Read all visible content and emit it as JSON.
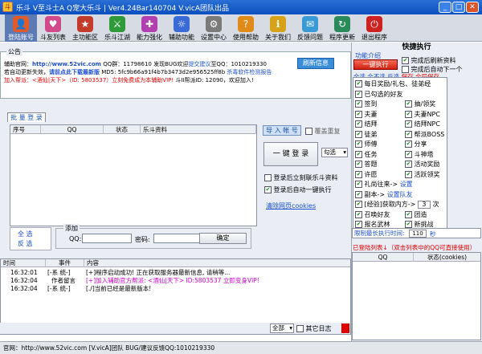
{
  "window": {
    "title": "乐斗 V至斗士A Q宠大乐斗 | Ver4.24Bar140704 V.vicA团队出品",
    "min_label": "_",
    "max_label": "□",
    "close_label": "✕"
  },
  "toolbar": {
    "items": [
      {
        "label": "登陆账号",
        "icon": "login-icon",
        "color": "#e05a2a"
      },
      {
        "label": "斗友列表",
        "icon": "friends-icon",
        "color": "#d14a8a"
      },
      {
        "label": "主功能区",
        "icon": "main-icon",
        "color": "#c23b2b"
      },
      {
        "label": "乐斗江湖",
        "icon": "jianghu-icon",
        "color": "#2e9a3a"
      },
      {
        "label": "能力强化",
        "icon": "enhance-icon",
        "color": "#b23fb0"
      },
      {
        "label": "辅助功能",
        "icon": "assist-icon",
        "color": "#3a6ad6"
      },
      {
        "label": "设置中心",
        "icon": "settings-icon",
        "color": "#7a7a7a"
      },
      {
        "label": "使用帮助",
        "icon": "help-icon",
        "color": "#e08a1a"
      },
      {
        "label": "关于我们",
        "icon": "about-icon",
        "color": "#d6a21a"
      },
      {
        "label": "反馈问题",
        "icon": "feedback-icon",
        "color": "#3a9ad6"
      },
      {
        "label": "程序更新",
        "icon": "update-icon",
        "color": "#2a8a5a"
      },
      {
        "label": "退出程序",
        "icon": "exit-icon",
        "color": "#c22"
      }
    ]
  },
  "notice": {
    "legend": "公告",
    "refresh_label": "刷新信息",
    "line1_a": "辅助官网：",
    "line1_url": "http://www.52vic.com",
    "line1_b": "  QQ群：11798610  发现BUG欢迎",
    "line1_c": "提交建议",
    "line1_d": "至QQ：1010219330",
    "line2_a": "若自动更新失效，",
    "line2_b": "请前点此下载最新版",
    "line2_c": "   MD5: 5fc9b66a91f4b7b3473d2e956525ff8b",
    "line2_d": "  杀毒软件检测报告",
    "line3_a": "加入帮派：<酒仙|天下>（ID: 5803537）立刻免费成为本辅助VIP!",
    "line3_b": "斗II帮派ID: 12090，欢迎加入!"
  },
  "batch": {
    "tab_label": "批 量 登 录",
    "columns": [
      "序号",
      "QQ",
      "状态",
      "乐斗资料"
    ],
    "import_label": "导 入 帐 号",
    "cover_label": "覆盖重复",
    "login_label": "一 键 登 录",
    "select_value": "勾选",
    "open_after_label": "登录后立刻联乐斗资料",
    "auto_exec_label": "登录后自动一键执行",
    "clear_cookies": "清除网页cookies",
    "select_all": "全 选",
    "invert": "反 选"
  },
  "add": {
    "legend": "添加",
    "qq_label": "QQ:",
    "pwd_label": "密码:",
    "confirm_label": "确定"
  },
  "log": {
    "columns": [
      "时间",
      "事件",
      "内容"
    ],
    "rows": [
      {
        "time": "16:32:01",
        "event": "[-系 统-]",
        "content": "[+]程序启动成功! 正在获取服务器最新信息, 请稍等..."
      },
      {
        "time": "16:32:04",
        "event": "作者留言",
        "content": "[+]加入辅助官方帮派: <酒仙|天下> ID:5803537 立即变身VIP!"
      },
      {
        "time": "16:32:04",
        "event": "[-系 统-]",
        "content": "[./]当前已经是最新版本!"
      }
    ],
    "filter_value": "全部",
    "other_log_label": "其它日志"
  },
  "status": {
    "text": "官网：http://www.52vic.com   [V.vicA]团队   BUG/建议反馈QQ:1010219330"
  },
  "quick": {
    "title": "快捷执行",
    "intro_label": "功能介绍",
    "exec_label": "一键执行",
    "after_refresh": "完成后刷新资料",
    "after_next": "完成后自动下一个",
    "select_all": "全选",
    "select_none": "全不选",
    "invert": "反选",
    "save": "保存",
    "save_all": "全局保存",
    "tasks_full": [
      "每日奖励/礼包、徒弟经",
      "已勾选的好友"
    ],
    "tasks_left": [
      "签到",
      "夫妻",
      "结拜",
      "徒弟",
      "师傅",
      "任务",
      "答题",
      "许愿"
    ],
    "tasks_right": [
      "抽/领奖",
      "夫妻NPC",
      "结拜NPC",
      "帮派BOSS",
      "分享",
      "斗神塔",
      "活动奖励",
      "活跃领奖"
    ],
    "gift_label": "礼尚往来->",
    "gift_link": "设置",
    "dungeon_label": "副本->",
    "dungeon_link": "设置队友",
    "exp_label": "[经验]获取内方->",
    "exp_value": "3",
    "exp_unit": "次",
    "sub_left": [
      "召唤好友",
      "报名武林"
    ],
    "sub_right": [
      "团造",
      "新挑战"
    ],
    "limit_label": "限制最长执行时间:",
    "limit_value": "110",
    "limit_unit": "秒",
    "logged_note": "已登陆列表↓（双击列表中的QQ可直接使用）",
    "acct_columns": [
      "QQ",
      "状态(cookies)"
    ]
  }
}
